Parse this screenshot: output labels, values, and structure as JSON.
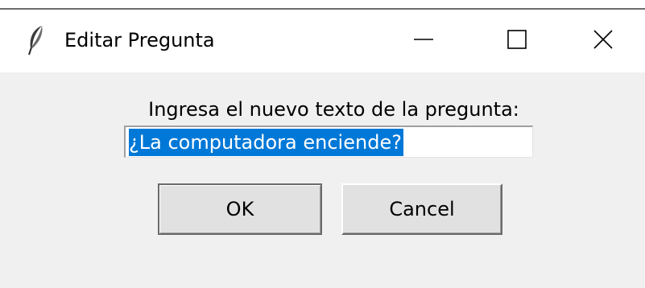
{
  "window": {
    "title": "Editar Pregunta",
    "app_icon": "feather-icon",
    "controls": {
      "minimize_icon": "minimize-icon",
      "maximize_icon": "maximize-icon",
      "close_icon": "close-icon"
    }
  },
  "dialog": {
    "prompt": "Ingresa el nuevo texto de la pregunta:",
    "entry_value": "¿La computadora enciende?",
    "ok_label": "OK",
    "cancel_label": "Cancel"
  },
  "colors": {
    "selection": "#0078d7",
    "dialog_background": "#f0f0f0",
    "button_face": "#e1e1e1"
  }
}
